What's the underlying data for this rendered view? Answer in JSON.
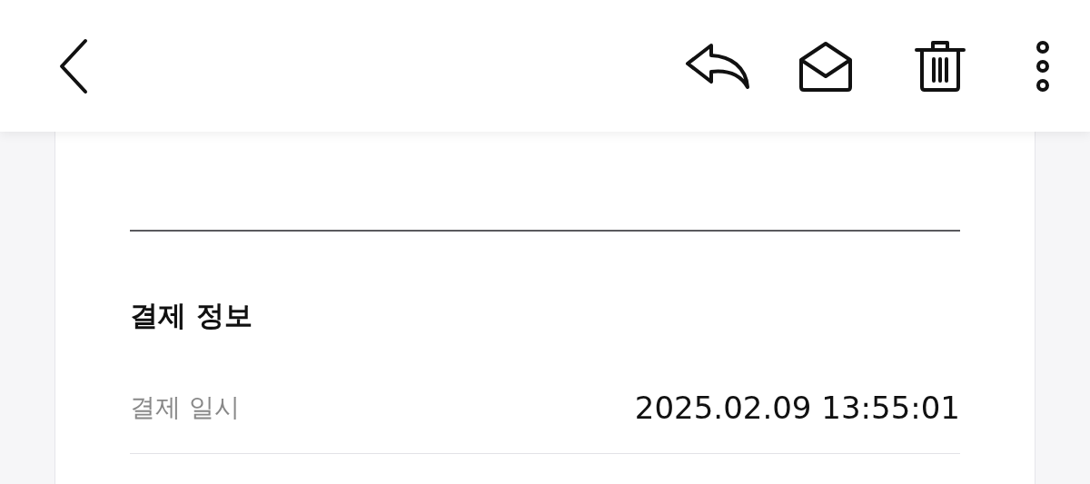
{
  "section": {
    "title": "결제 정보",
    "rows": [
      {
        "label": "결제 일시",
        "value": "2025.02.09 13:55:01"
      }
    ]
  }
}
